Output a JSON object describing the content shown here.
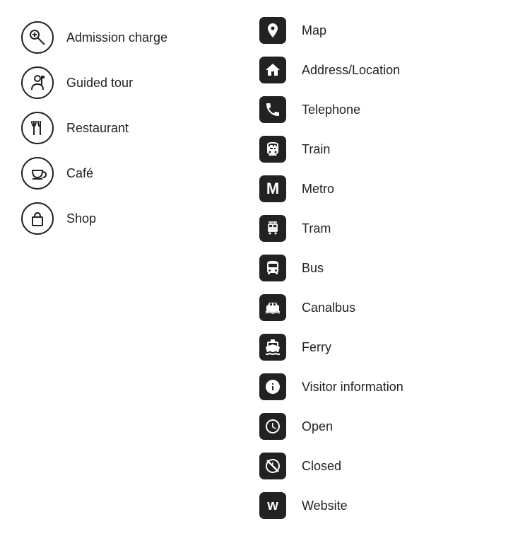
{
  "left_items": [
    {
      "id": "admission-charge",
      "label": "Admission charge",
      "icon_type": "circle",
      "icon": "admission"
    },
    {
      "id": "guided-tour",
      "label": "Guided tour",
      "icon_type": "circle",
      "icon": "guided-tour"
    },
    {
      "id": "restaurant",
      "label": "Restaurant",
      "icon_type": "circle",
      "icon": "restaurant"
    },
    {
      "id": "cafe",
      "label": "Café",
      "icon_type": "circle",
      "icon": "cafe"
    },
    {
      "id": "shop",
      "label": "Shop",
      "icon_type": "circle",
      "icon": "shop"
    }
  ],
  "right_items": [
    {
      "id": "map",
      "label": "Map",
      "icon_type": "square",
      "icon": "map"
    },
    {
      "id": "address",
      "label": "Address/Location",
      "icon_type": "square",
      "icon": "address"
    },
    {
      "id": "telephone",
      "label": "Telephone",
      "icon_type": "square",
      "icon": "telephone"
    },
    {
      "id": "train",
      "label": "Train",
      "icon_type": "square",
      "icon": "train"
    },
    {
      "id": "metro",
      "label": "Metro",
      "icon_type": "square",
      "icon": "metro"
    },
    {
      "id": "tram",
      "label": "Tram",
      "icon_type": "square",
      "icon": "tram"
    },
    {
      "id": "bus",
      "label": "Bus",
      "icon_type": "square",
      "icon": "bus"
    },
    {
      "id": "canalbus",
      "label": "Canalbus",
      "icon_type": "square",
      "icon": "canalbus"
    },
    {
      "id": "ferry",
      "label": "Ferry",
      "icon_type": "square",
      "icon": "ferry"
    },
    {
      "id": "visitor-info",
      "label": "Visitor information",
      "icon_type": "square",
      "icon": "visitor-info"
    },
    {
      "id": "open",
      "label": "Open",
      "icon_type": "square",
      "icon": "open"
    },
    {
      "id": "closed",
      "label": "Closed",
      "icon_type": "square",
      "icon": "closed"
    },
    {
      "id": "website",
      "label": "Website",
      "icon_type": "square",
      "icon": "website"
    }
  ]
}
